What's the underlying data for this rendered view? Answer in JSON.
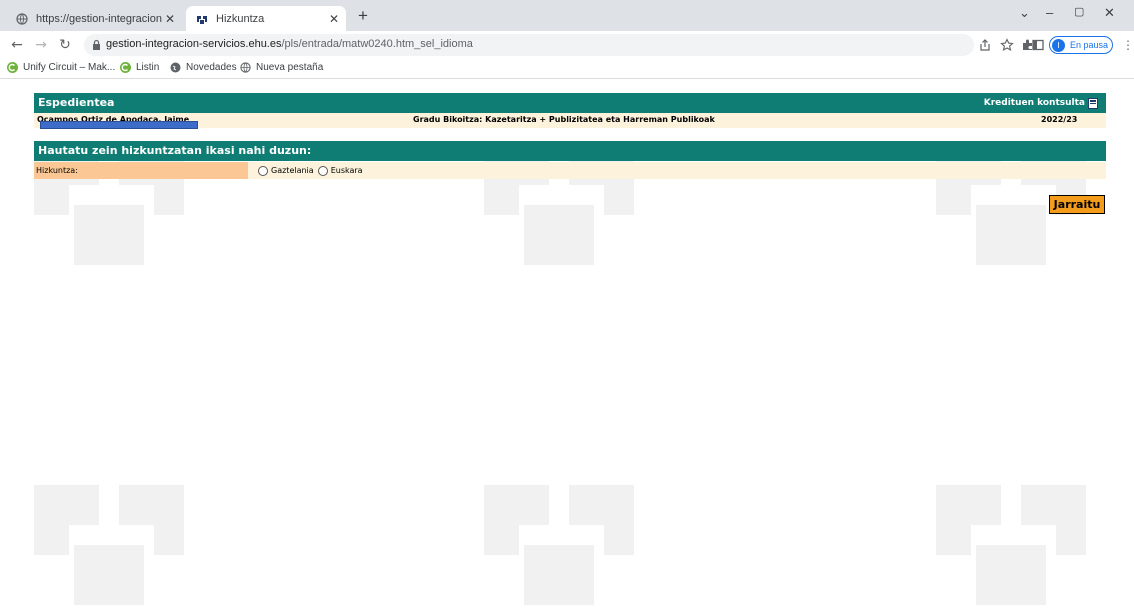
{
  "browser": {
    "tabs": [
      {
        "title": "https://gestion-integracion-servic",
        "close": "✕"
      },
      {
        "title": "Hizkuntza",
        "close": "✕"
      }
    ],
    "new_tab": "+",
    "window_controls": {
      "minimize": "–",
      "maximize": "🗗",
      "close": "✕"
    },
    "url_host": "gestion-integracion-servicios.ehu.es",
    "url_path": "/pls/entrada/matw0240.htm_sel_idioma",
    "profile_initial": "I",
    "profile_label": "En pausa",
    "menu": "⋮",
    "bookmarks": [
      "Unify Circuit – Mak...",
      "Listin",
      "Novedades",
      "Nueva pestaña"
    ],
    "colors": {
      "tabbar": "#dee1e6",
      "accent": "#1a73e8"
    }
  },
  "page": {
    "header_title": "Espedientea",
    "credits_link": "Kredituen kontsulta",
    "student_name": "Ocampos Ortiz de Apodaca, Jaime",
    "degree": "Gradu Bikoitza: Kazetaritza + Publizitatea eta Harreman Publikoak",
    "year": "2022/23",
    "section_title": "Hautatu zein hizkuntzatan ikasi nahi duzun:",
    "language_label": "Hizkuntza:",
    "options": [
      "Gaztelania",
      "Euskara"
    ],
    "continue_button": "Jarraitu",
    "colors": {
      "header": "#0f7d74",
      "row": "#fdf3dc",
      "label": "#fbc895",
      "button": "#f39b1b"
    }
  }
}
